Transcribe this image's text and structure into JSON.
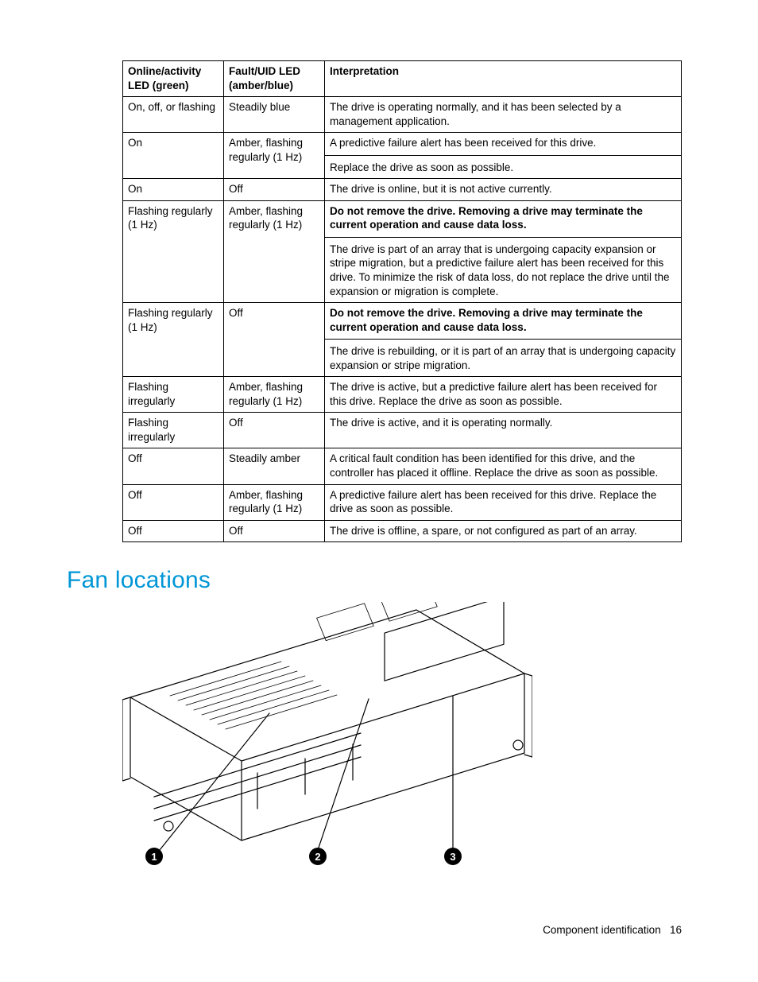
{
  "table": {
    "headers": {
      "col1": "Online/activity LED (green)",
      "col2": "Fault/UID LED (amber/blue)",
      "col3": "Interpretation"
    },
    "rows": [
      {
        "c1": "On, off, or flashing",
        "c2": "Steadily blue",
        "interp": [
          {
            "text": "The drive is operating normally, and it has been selected by a management application.",
            "bold": false
          }
        ]
      },
      {
        "c1": "On",
        "c2": "Amber, flashing regularly (1 Hz)",
        "interp": [
          {
            "text": "A predictive failure alert has been received for this drive.",
            "bold": false
          },
          {
            "sep": true
          },
          {
            "text": "Replace the drive as soon as possible.",
            "bold": false
          }
        ]
      },
      {
        "c1": "On",
        "c2": "Off",
        "interp": [
          {
            "text": "The drive is online, but it is not active currently.",
            "bold": false
          }
        ]
      },
      {
        "c1": "Flashing regularly (1 Hz)",
        "c2": "Amber, flashing regularly (1 Hz)",
        "interp": [
          {
            "text": "Do not remove the drive. Removing a drive may terminate the current operation and cause data loss.",
            "bold": true
          },
          {
            "sep": true
          },
          {
            "text": "The drive is part of an array that is undergoing capacity expansion or stripe migration, but a predictive failure alert has been received for this drive. To minimize the risk of data loss, do not replace the drive until the expansion or migration is complete.",
            "bold": false
          }
        ]
      },
      {
        "c1": "Flashing regularly (1 Hz)",
        "c2": "Off",
        "interp": [
          {
            "text": "Do not remove the drive. Removing a drive may terminate the current operation and cause data loss.",
            "bold": true
          },
          {
            "sep": true
          },
          {
            "text": "The drive is rebuilding, or it is part of an array that is undergoing capacity expansion or stripe migration.",
            "bold": false
          }
        ]
      },
      {
        "c1": "Flashing irregularly",
        "c2": "Amber, flashing regularly (1 Hz)",
        "interp": [
          {
            "text": "The drive is active, but a predictive failure alert has been received for this drive. Replace the drive as soon as possible.",
            "bold": false
          }
        ]
      },
      {
        "c1": "Flashing irregularly",
        "c2": "Off",
        "interp": [
          {
            "text": "The drive is active, and it is operating normally.",
            "bold": false
          }
        ]
      },
      {
        "c1": "Off",
        "c2": "Steadily amber",
        "interp": [
          {
            "text": "A critical fault condition has been identified for this drive, and the controller has placed it offline. Replace the drive as soon as possible.",
            "bold": false
          }
        ]
      },
      {
        "c1": "Off",
        "c2": "Amber, flashing regularly (1 Hz)",
        "interp": [
          {
            "text": "A predictive failure alert has been received for this drive. Replace the drive as soon as possible.",
            "bold": false
          }
        ]
      },
      {
        "c1": "Off",
        "c2": "Off",
        "interp": [
          {
            "text": "The drive is offline, a spare, or not configured as part of an array.",
            "bold": false
          }
        ]
      }
    ]
  },
  "section_heading": "Fan locations",
  "callouts": [
    "1",
    "2",
    "3"
  ],
  "footer": {
    "section": "Component identification",
    "page": "16"
  }
}
